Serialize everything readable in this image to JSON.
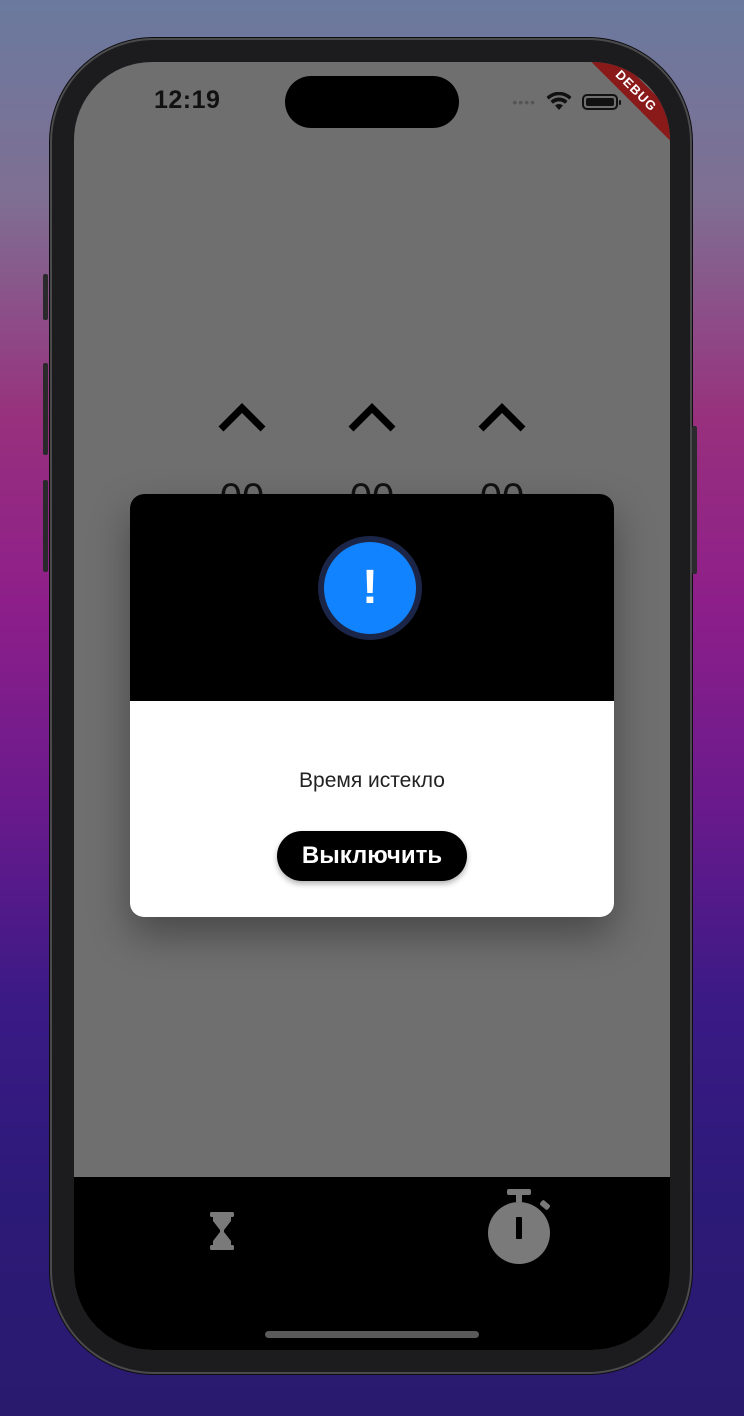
{
  "status_bar": {
    "time": "12:19",
    "signal_icon": "cellular-dots-icon",
    "wifi_icon": "wifi-icon",
    "battery_icon": "battery-icon"
  },
  "debug_banner": "DEBUG",
  "picker": {
    "up_icon": "chevron-up-icon",
    "columns": [
      {
        "value": "00"
      },
      {
        "value": "00"
      },
      {
        "value": "00"
      }
    ]
  },
  "dialog": {
    "icon": "alert-exclamation-icon",
    "icon_glyph": "!",
    "message": "Время истекло",
    "button_label": "Выключить",
    "colors": {
      "header": "#000000",
      "icon_fill": "#1283ff",
      "body": "#ffffff"
    }
  },
  "tab_bar": {
    "items": [
      {
        "icon": "hourglass-icon",
        "active": false
      },
      {
        "icon": "stopwatch-icon",
        "active": false
      }
    ]
  },
  "colors": {
    "screen_overlay": "#6f6f6f",
    "tab_bar": "#000000",
    "debug_banner": "#8a1a1a"
  }
}
